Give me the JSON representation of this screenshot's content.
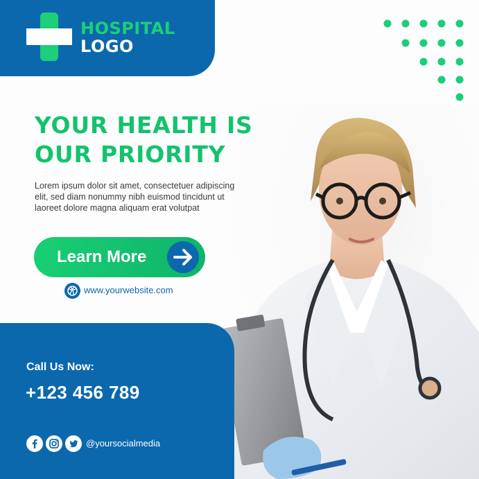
{
  "logo": {
    "line1": "HOSPITAL",
    "line2": "LOGO",
    "mark_icon": "medical-cross-icon"
  },
  "hero": {
    "headline_line1": "YOUR HEALTH IS",
    "headline_line2": "OUR PRIORITY",
    "body_line1": "Lorem ipsum dolor sit amet, consectetuer adipiscing",
    "body_line2": "elit, sed diam nonummy nibh euismod tincidunt ut",
    "body_line3": "laoreet dolore magna aliquam erat volutpat"
  },
  "cta": {
    "label": "Learn More",
    "arrow_icon": "arrow-right-icon"
  },
  "website": {
    "icon": "globe-icon",
    "text": "www.yourwebsite.com"
  },
  "contact": {
    "call_label": "Call Us Now:",
    "phone": "+123 456 789"
  },
  "social": {
    "icons": [
      "facebook-icon",
      "instagram-icon",
      "twitter-icon"
    ],
    "handle": "@yoursocialmedia"
  },
  "colors": {
    "primary_blue": "#0b68ad",
    "accent_green": "#1ccf78",
    "headline_green": "#14c26e"
  },
  "photo": {
    "icon": "doctor-photo"
  }
}
